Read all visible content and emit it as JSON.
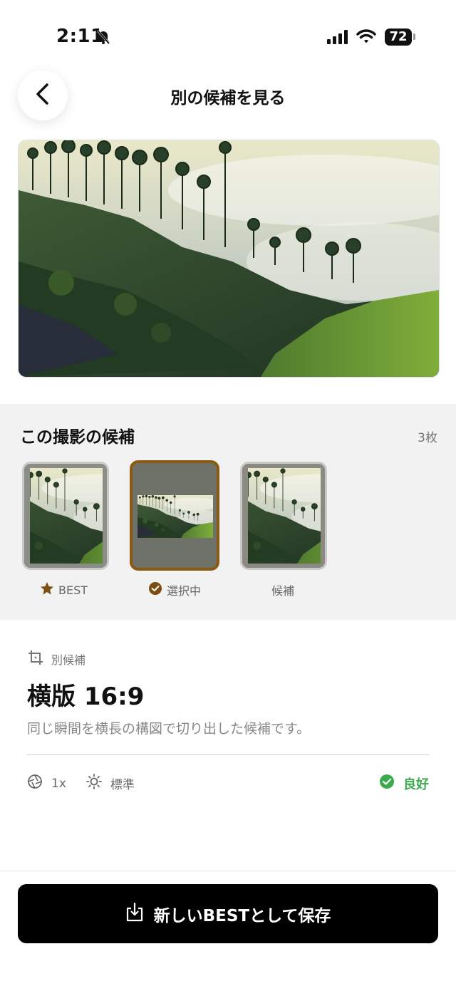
{
  "status_bar": {
    "time": "2:11",
    "battery": "72",
    "icons": [
      "bell-slash-icon",
      "signal-icon",
      "wifi-icon",
      "battery-icon"
    ]
  },
  "header": {
    "title": "別の候補を見る",
    "back_icon": "chevron-left-icon"
  },
  "candidates": {
    "title": "この撮影の候補",
    "count": "3枚",
    "items": [
      {
        "label": "BEST",
        "icon": "star-icon"
      },
      {
        "label": "選択中",
        "icon": "check-circle-icon"
      },
      {
        "label": "候補",
        "icon": ""
      }
    ]
  },
  "detail": {
    "tag": "別候補",
    "tag_icon": "crop-icon",
    "title": "横版 16:9",
    "description": "同じ瞬間を横長の構図で切り出した候補です。",
    "zoom": "1x",
    "zoom_icon": "aperture-icon",
    "exposure": "標準",
    "exposure_icon": "sun-icon",
    "quality": "良好",
    "quality_icon": "check-circle-icon"
  },
  "save_button": {
    "label": "新しいBESTとして保存",
    "icon": "download-icon"
  },
  "colors": {
    "accent": "#8a5a12",
    "good": "#3cab4f",
    "button_bg": "#000000"
  }
}
